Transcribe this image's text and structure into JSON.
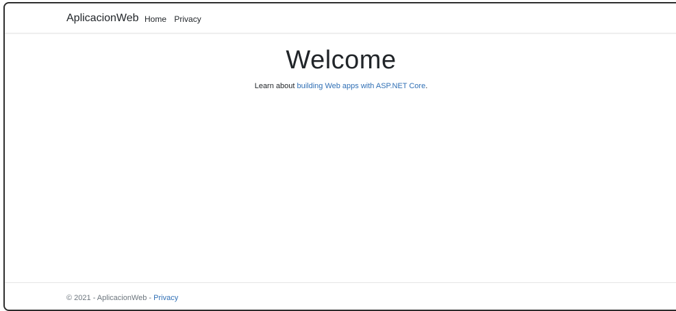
{
  "navbar": {
    "brand": "AplicacionWeb",
    "links": [
      "Home",
      "Privacy"
    ]
  },
  "main": {
    "heading": "Welcome",
    "intro_prefix": "Learn about ",
    "intro_link": "building Web apps with ASP.NET Core",
    "intro_suffix": "."
  },
  "footer": {
    "prefix": "© 2021 - AplicacionWeb - ",
    "privacy_link": "Privacy"
  },
  "colors": {
    "link": "#2f6fb5",
    "text": "#212529",
    "muted": "#6c757d",
    "border": "#e5e5e5"
  }
}
